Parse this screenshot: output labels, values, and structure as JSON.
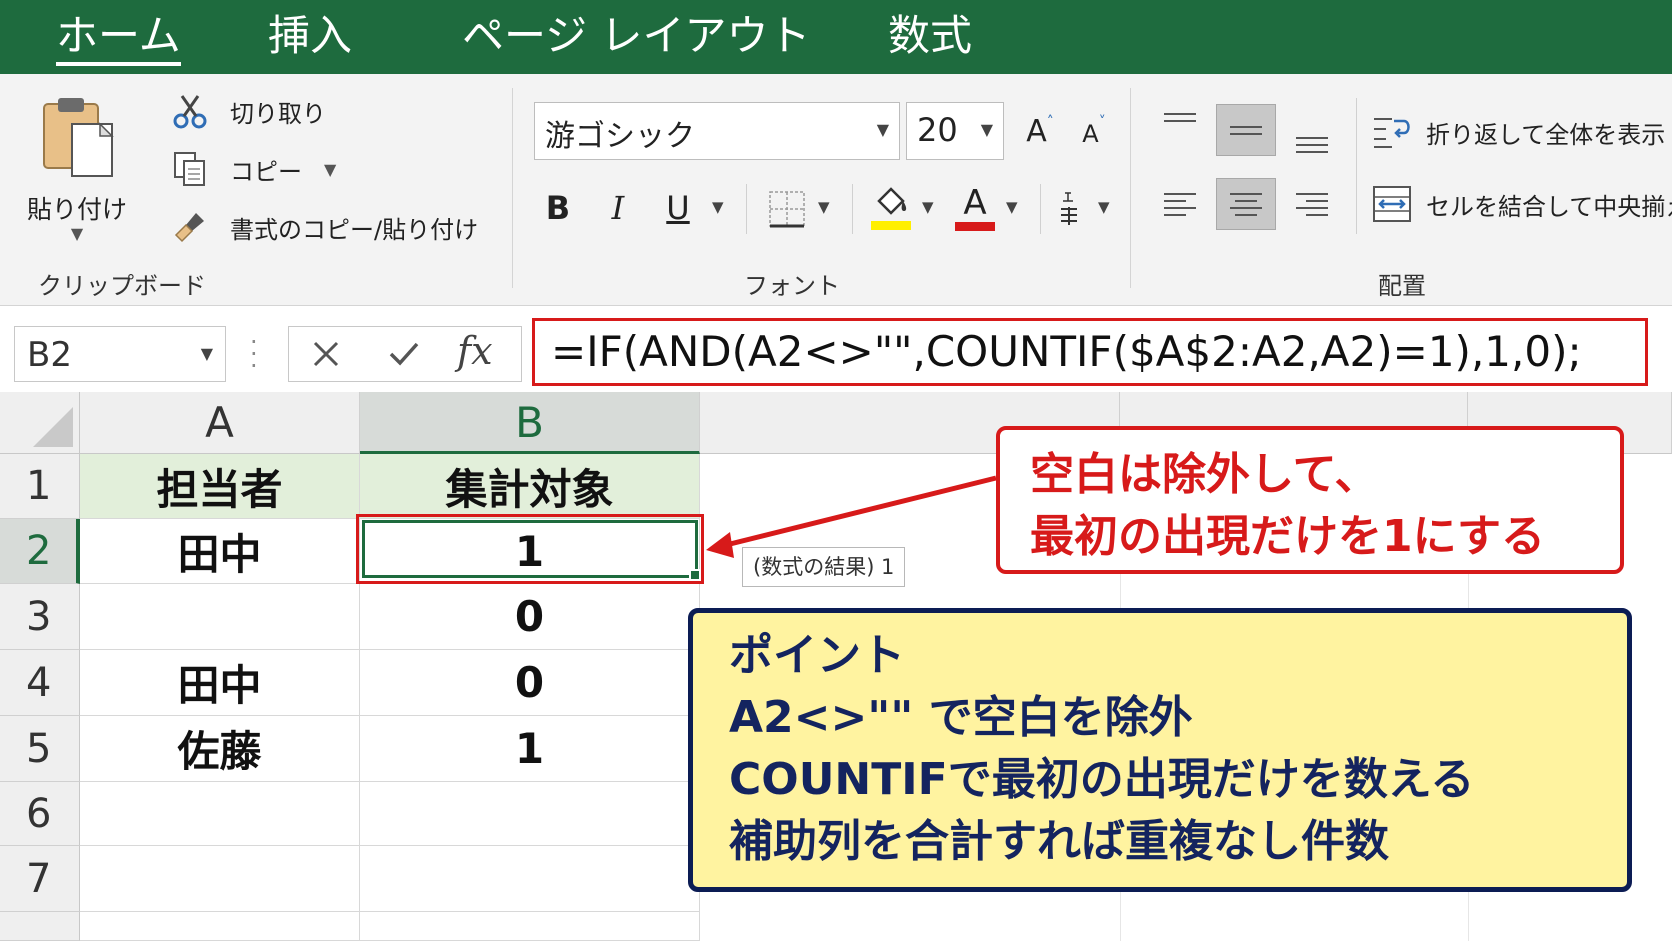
{
  "menu": {
    "tabs": [
      {
        "label": "ホーム",
        "active": true
      },
      {
        "label": "挿入"
      },
      {
        "label": "ページ レイアウト"
      },
      {
        "label": "数式"
      }
    ]
  },
  "ribbon": {
    "clipboard": {
      "paste_label": "貼り付け",
      "cut_label": "切り取り",
      "copy_label": "コピー",
      "format_painter_label": "書式のコピー/貼り付け",
      "group_label": "クリップボード"
    },
    "font": {
      "font_name": "游ゴシック",
      "font_size": "20",
      "grow_glyph": "A",
      "shrink_glyph": "A",
      "bold_glyph": "B",
      "italic_glyph": "I",
      "underline_glyph": "U",
      "font_color_glyph": "A",
      "highlight_color": "#ffef00",
      "font_color": "#d71a1a",
      "group_label": "フォント"
    },
    "alignment": {
      "wrap_text_label": "折り返して全体を表示",
      "merge_center_label": "セルを結合して中央揃え",
      "group_label": "配置"
    }
  },
  "formula_bar": {
    "name_box": "B2",
    "fx_glyph": "fx",
    "formula": "=IF(AND(A2<>\"\",COUNTIF($A$2:A2,A2)=1),1,0);"
  },
  "sheet": {
    "columns": [
      "A",
      "B"
    ],
    "selected_column": "B",
    "rows": [
      "1",
      "2",
      "3",
      "4",
      "5",
      "6",
      "7"
    ],
    "selected_row": "2",
    "cells": [
      {
        "a": "担当者",
        "b": "集計対象"
      },
      {
        "a": "田中",
        "b": "1"
      },
      {
        "a": "",
        "b": "0"
      },
      {
        "a": "田中",
        "b": "0"
      },
      {
        "a": "佐藤",
        "b": "1"
      },
      {
        "a": "",
        "b": ""
      },
      {
        "a": "",
        "b": ""
      }
    ],
    "header_fill": "#e2efda",
    "selected_cell": "B2"
  },
  "tooltip": "(数式の結果) 1",
  "callout_red": {
    "line1": "空白は除外して、",
    "line2": "最初の出現だけを1にする",
    "color": "#d71a1a"
  },
  "callout_point": {
    "title": "ポイント",
    "line1": "A2<>\"\" で空白を除外",
    "line2": "COUNTIFで最初の出現だけを数える",
    "line3": "補助列を合計すれば重複なし件数",
    "fill": "#fff3a0",
    "border": "#0c1c54"
  },
  "colors": {
    "excel_green": "#1e6b3e",
    "accent_red": "#d71a1a"
  }
}
